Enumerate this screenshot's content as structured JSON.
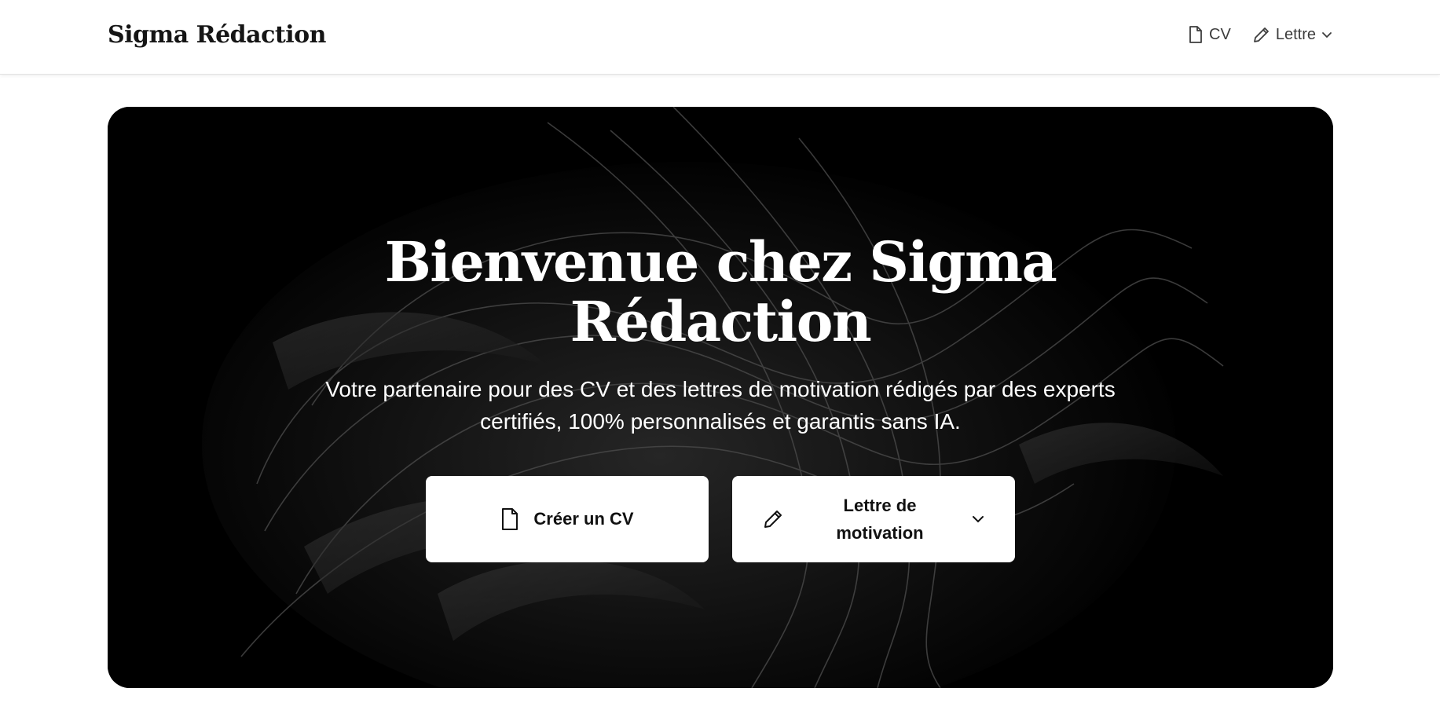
{
  "header": {
    "brand": "Sigma Rédaction",
    "nav": {
      "cv_label": "CV",
      "letter_label": "Lettre"
    }
  },
  "hero": {
    "title": "Bienvenue chez Sigma Rédaction",
    "subtitle": "Votre partenaire pour des CV et des lettres de motivation rédigés par des experts certifiés, 100% personnalisés et garantis sans IA.",
    "buttons": {
      "create_cv": "Créer un CV",
      "cover_letter": "Lettre de motivation"
    }
  },
  "icons": {
    "cv": "file-icon",
    "letter": "pencil-icon",
    "dropdown": "chevron-down-icon"
  },
  "colors": {
    "hero_background": "#000000",
    "button_background": "#ffffff",
    "page_background": "#ffffff"
  }
}
